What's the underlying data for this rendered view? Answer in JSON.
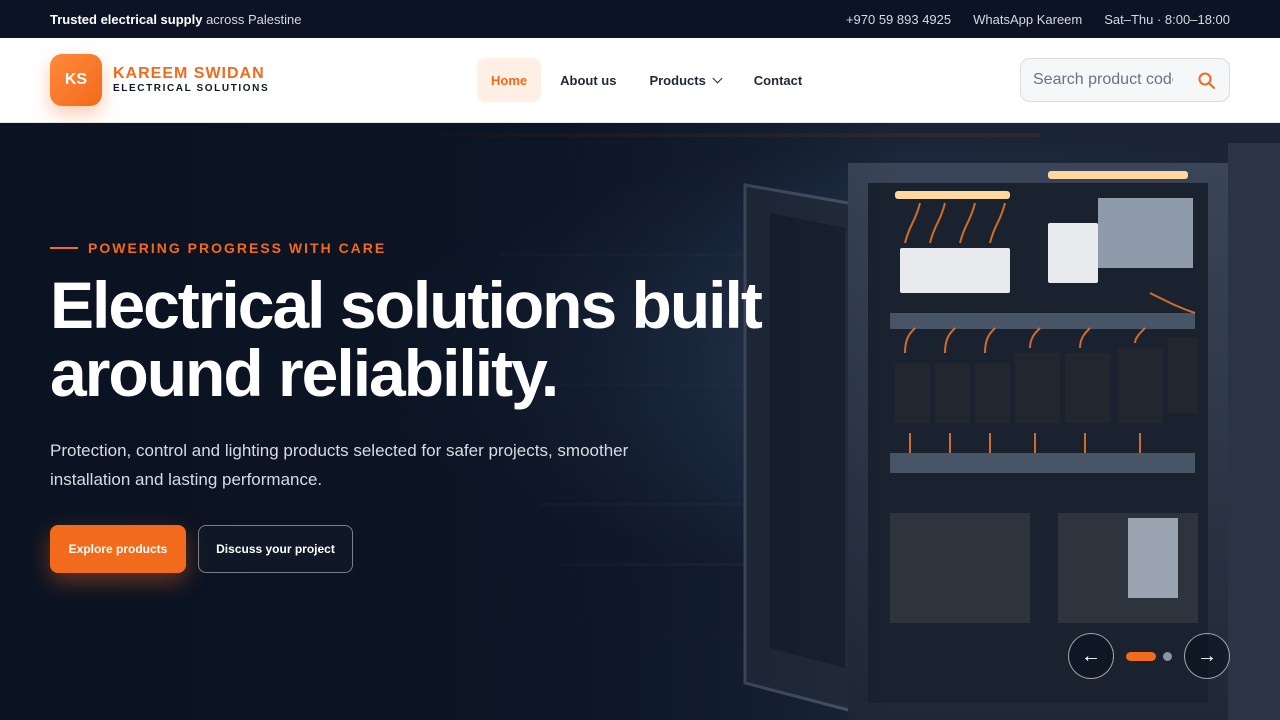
{
  "topbar": {
    "lead_bold": "Trusted electrical supply",
    "lead_rest": " across Palestine",
    "phone": "+970 59 893 4925",
    "whatsapp": "WhatsApp Kareem",
    "hours": "Sat–Thu · 8:00–18:00"
  },
  "brand": {
    "initials": "KS",
    "name": "KAREEM SWIDAN",
    "tagline": "ELECTRICAL SOLUTIONS",
    "accent_color": "#f26a1b"
  },
  "nav": {
    "items": [
      {
        "label": "Home",
        "active": true
      },
      {
        "label": "About us",
        "active": false
      },
      {
        "label": "Products",
        "active": false,
        "dropdown": true
      },
      {
        "label": "Contact",
        "active": false
      }
    ]
  },
  "search": {
    "placeholder": "Search product code",
    "icon": "search-icon"
  },
  "hero": {
    "eyebrow": "POWERING PROGRESS WITH CARE",
    "headline_line1": "Electrical solutions built",
    "headline_line2": "around reliability.",
    "subtext": "Protection, control and lighting products selected for safer projects, smoother installation and lasting performance.",
    "primary_cta": "Explore products",
    "secondary_cta": "Discuss your project",
    "prev_symbol": "←",
    "next_symbol": "→",
    "slider": {
      "current": 1,
      "total": 2
    }
  }
}
